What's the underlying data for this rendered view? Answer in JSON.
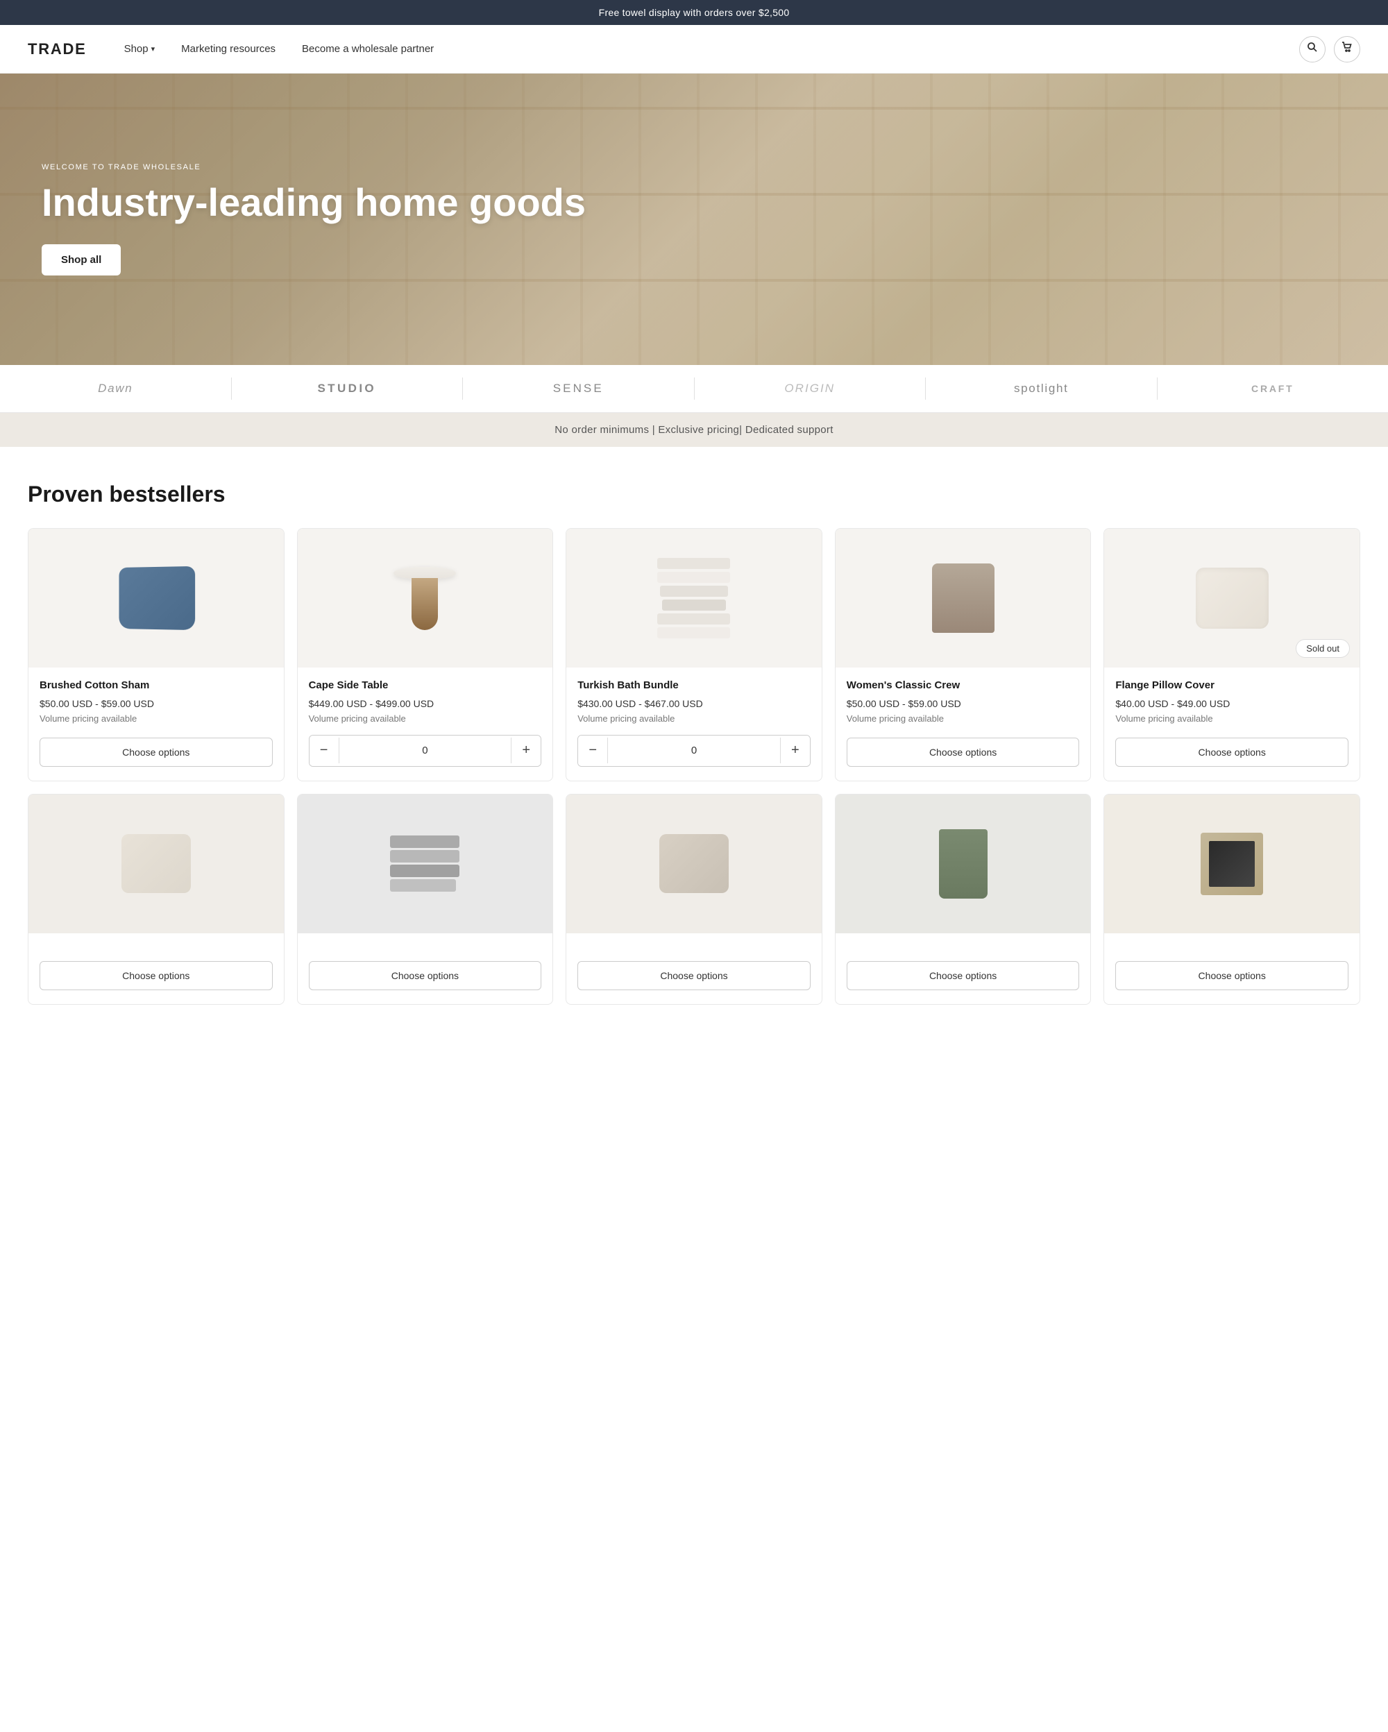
{
  "announcement": {
    "text": "Free towel display with orders over $2,500"
  },
  "header": {
    "logo": "TRADE",
    "nav": [
      {
        "label": "Shop",
        "hasDropdown": true
      },
      {
        "label": "Marketing resources"
      },
      {
        "label": "Become a wholesale partner"
      }
    ],
    "icons": {
      "search": "🔍",
      "cart": "🛒"
    }
  },
  "hero": {
    "eyebrow": "WELCOME TO TRADE WHOLESALE",
    "title": "Industry-leading home goods",
    "cta": "Shop all"
  },
  "brands": [
    {
      "label": "Dawn",
      "style": "dawn"
    },
    {
      "label": "STUDIO",
      "style": "studio"
    },
    {
      "label": "SENSE",
      "style": "sense"
    },
    {
      "label": "ORIGIN",
      "style": "origin"
    },
    {
      "label": "spotlight",
      "style": "spotlight"
    },
    {
      "label": "CRAFT",
      "style": "craft"
    }
  ],
  "value_props": "No order minimums | Exclusive pricing| Dedicated support",
  "bestsellers": {
    "title": "Proven bestsellers",
    "products_row1": [
      {
        "name": "Brushed Cotton Sham",
        "price": "$50.00 USD - $59.00 USD",
        "volume": "Volume pricing available",
        "cta": "Choose options",
        "sold_out": false,
        "image_type": "pillow-blue",
        "has_qty": false
      },
      {
        "name": "Cape Side Table",
        "price": "$449.00 USD - $499.00 USD",
        "volume": "Volume pricing available",
        "cta": null,
        "sold_out": false,
        "image_type": "side-table",
        "has_qty": true,
        "qty": "0"
      },
      {
        "name": "Turkish Bath Bundle",
        "price": "$430.00 USD - $467.00 USD",
        "volume": "Volume pricing available",
        "cta": null,
        "sold_out": false,
        "image_type": "towels",
        "has_qty": true,
        "qty": "0"
      },
      {
        "name": "Women's Classic Crew",
        "price": "$50.00 USD - $59.00 USD",
        "volume": "Volume pricing available",
        "cta": "Choose options",
        "sold_out": false,
        "image_type": "womens-top",
        "has_qty": false
      },
      {
        "name": "Flange Pillow Cover",
        "price": "$40.00 USD - $49.00 USD",
        "volume": "Volume pricing available",
        "cta": "Choose options",
        "sold_out": true,
        "sold_out_label": "Sold out",
        "image_type": "pillow-cream",
        "has_qty": false
      }
    ],
    "products_row2": [
      {
        "name": "",
        "price": "",
        "volume": "",
        "cta": "Choose options",
        "sold_out": false,
        "image_type": "pillow-cream2",
        "has_qty": false
      },
      {
        "name": "",
        "price": "",
        "volume": "",
        "cta": "Choose options",
        "sold_out": false,
        "image_type": "towels-gray",
        "has_qty": false
      },
      {
        "name": "",
        "price": "",
        "volume": "",
        "cta": "Choose options",
        "sold_out": false,
        "image_type": "pillow-natural",
        "has_qty": false
      },
      {
        "name": "",
        "price": "",
        "volume": "",
        "cta": "Choose options",
        "sold_out": false,
        "image_type": "pants-green",
        "has_qty": false
      },
      {
        "name": "",
        "price": "",
        "volume": "",
        "cta": "Choose options",
        "sold_out": false,
        "image_type": "frame-beige",
        "has_qty": false
      }
    ]
  }
}
